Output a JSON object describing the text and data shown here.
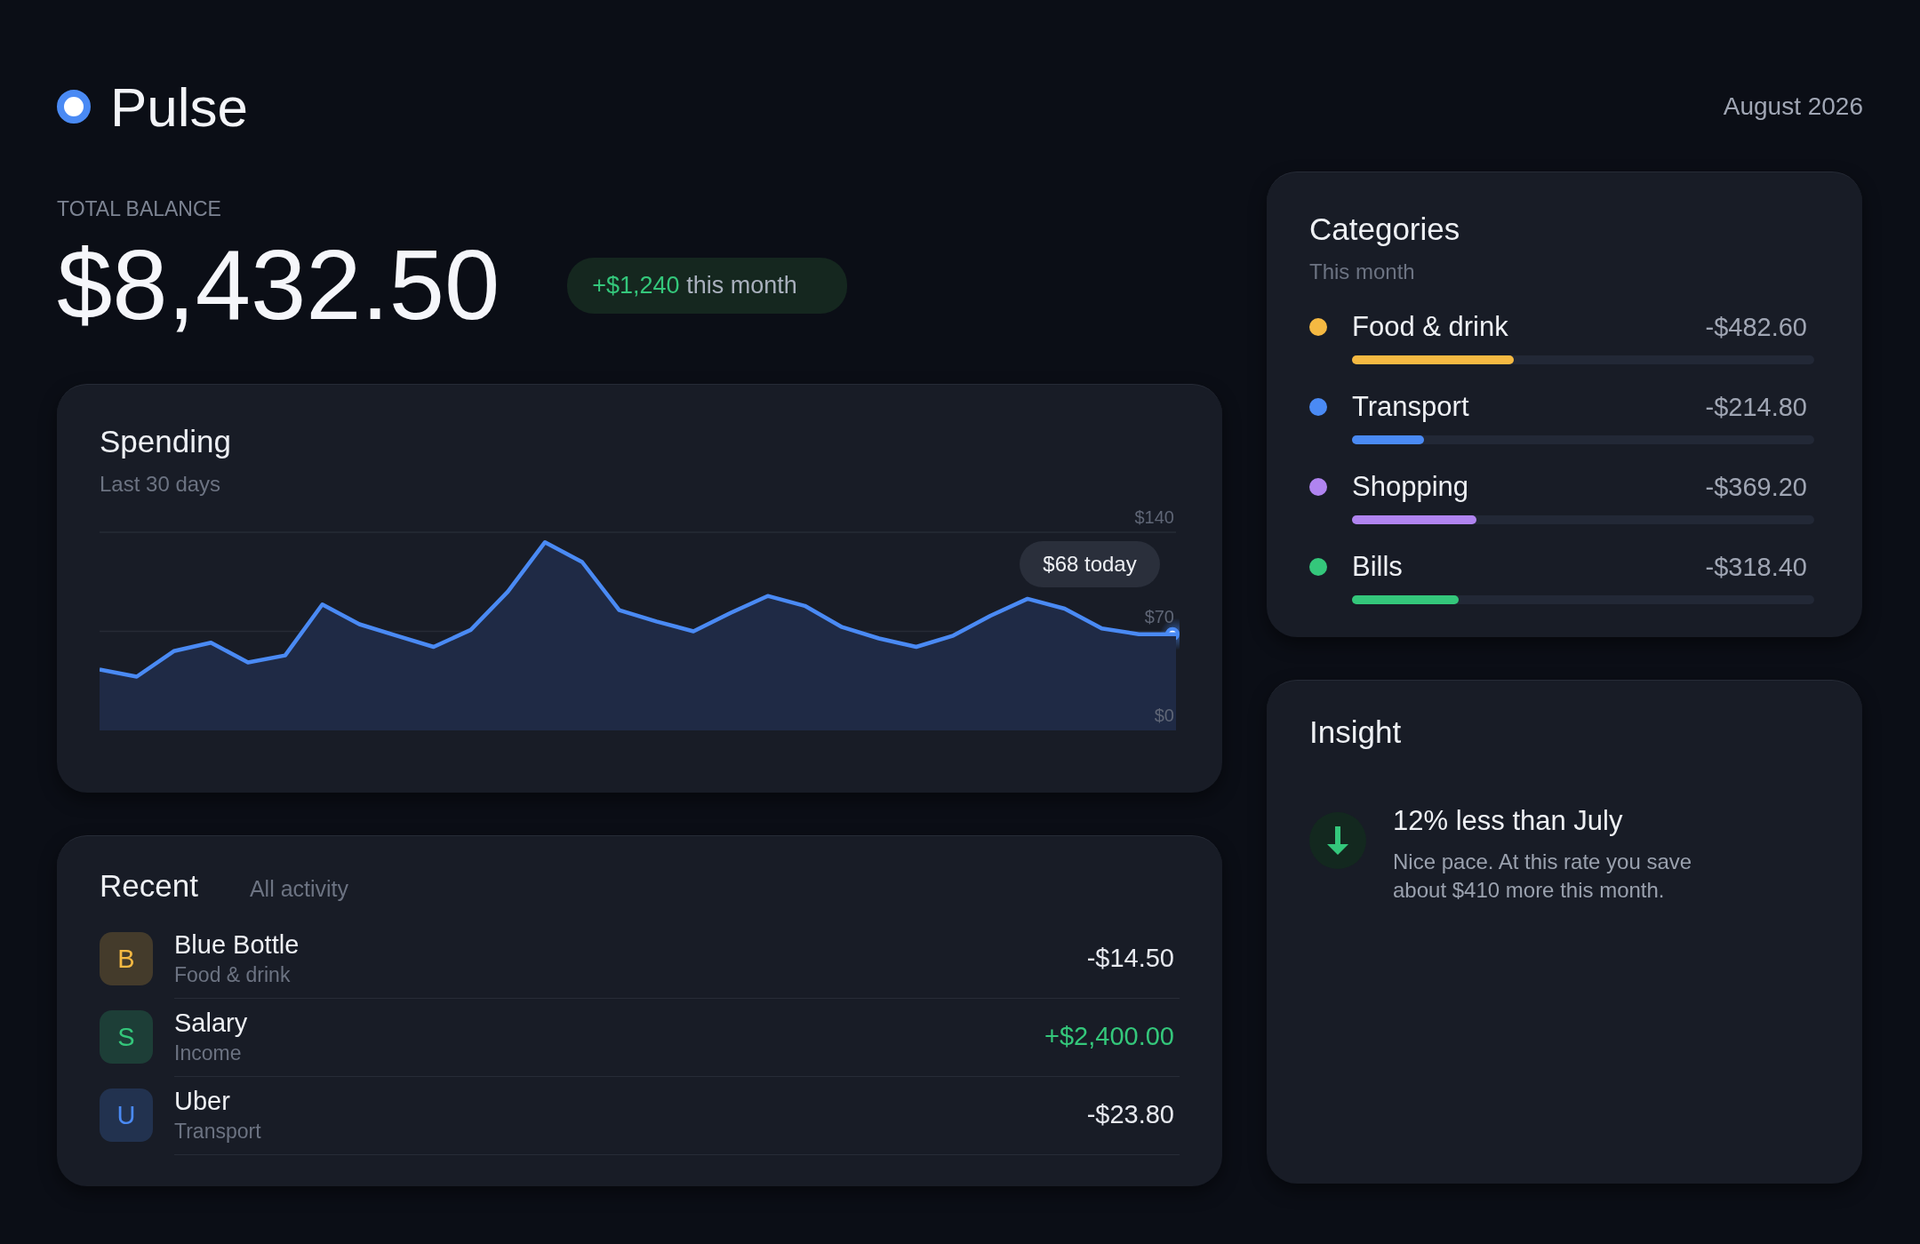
{
  "header": {
    "logo": "Pulse",
    "date": "August 2026"
  },
  "balance": {
    "label": "TOTAL BALANCE",
    "amount": "$8,432.50",
    "change": "+$1,240",
    "change_note": "this month"
  },
  "spending": {
    "title": "Spending",
    "subtitle": "Last 30 days",
    "tooltip": "$68 today",
    "chart_data": {
      "type": "area",
      "ylim": [
        0,
        140
      ],
      "yticks": [
        {
          "value": 0,
          "label": "$0"
        },
        {
          "value": 70,
          "label": "$70"
        },
        {
          "value": 140,
          "label": "$140"
        }
      ],
      "series": [
        {
          "color": "#4a8af4",
          "values": [
            43,
            38,
            56,
            62,
            48,
            53,
            89,
            75,
            67,
            59,
            71,
            98,
            133,
            119,
            85,
            77,
            70,
            83,
            95,
            88,
            73,
            65,
            59,
            67,
            81,
            93,
            86,
            72,
            68,
            68
          ]
        }
      ]
    }
  },
  "recent": {
    "title": "Recent",
    "link": "All activity",
    "items": [
      {
        "initial": "B",
        "name": "Blue Bottle",
        "category": "Food & drink",
        "amount": "-$14.50",
        "kind": "debit",
        "color": "#f5b942"
      },
      {
        "initial": "S",
        "name": "Salary",
        "category": "Income",
        "amount": "+$2,400.00",
        "kind": "credit",
        "color": "#34c77b"
      },
      {
        "initial": "U",
        "name": "Uber",
        "category": "Transport",
        "amount": "-$23.80",
        "kind": "debit",
        "color": "#4a8af4"
      }
    ]
  },
  "categories": {
    "title": "Categories",
    "subtitle": "This month",
    "items": [
      {
        "name": "Food & drink",
        "amount": "-$482.60",
        "color": "#f5b942",
        "level": 0.35
      },
      {
        "name": "Transport",
        "amount": "-$214.80",
        "color": "#4a8af4",
        "level": 0.155
      },
      {
        "name": "Shopping",
        "amount": "-$369.20",
        "color": "#b084f0",
        "level": 0.27
      },
      {
        "name": "Bills",
        "amount": "-$318.40",
        "color": "#34c77b",
        "level": 0.23
      }
    ]
  },
  "insight": {
    "title": "Insight",
    "headline": "12% less than July",
    "body": "Nice pace. At this rate you save about $410 more this month."
  }
}
